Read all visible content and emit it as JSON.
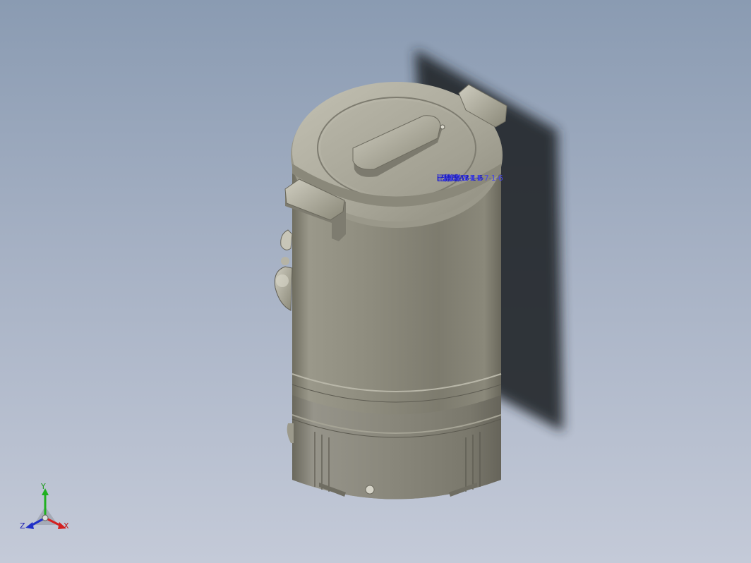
{
  "viewport": {
    "background_top": "#8a9bb2",
    "background_bottom": "#c4cad8"
  },
  "model": {
    "body_color": "#8e8c7c",
    "shadow_color": "#2a2d33"
  },
  "annotation": {
    "line1": "已修改-W-1-2",
    "line2": "已修改-D-1-1",
    "line3": "已修改-1-1-6",
    "line4": "已修改-3-1-5",
    "line5": "1-1-7-1-0-1-7-1-6",
    "color": "#1a1ad0"
  },
  "triad": {
    "x_label": "X",
    "y_label": "Y",
    "z_label": "Z",
    "x_color": "#d42020",
    "y_color": "#20b020",
    "z_color": "#2030c8"
  }
}
